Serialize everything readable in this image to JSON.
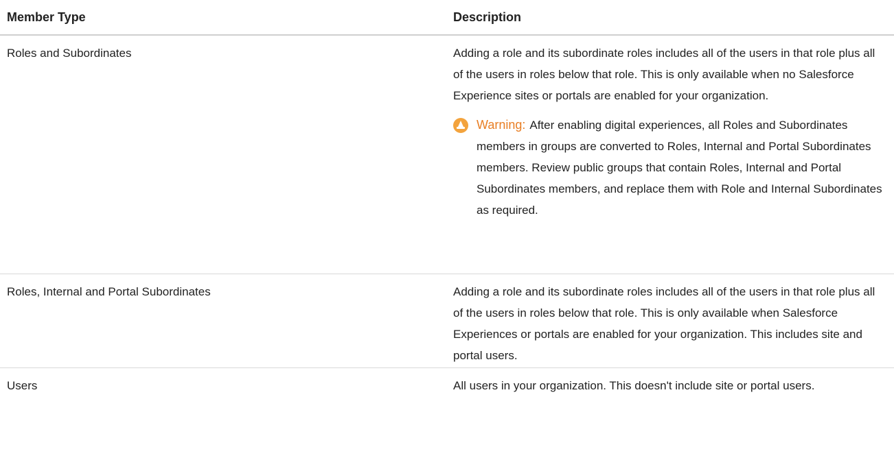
{
  "table": {
    "headers": {
      "member_type": "Member Type",
      "description": "Description"
    },
    "rows": [
      {
        "member_type": "Roles and Subordinates",
        "description": "Adding a role and its subordinate roles includes all of the users in that role plus all of the users in roles below that role. This is only available when no Salesforce Experience sites or portals are enabled for your organization.",
        "warning": {
          "icon": "warning-cone-icon",
          "label": "Warning:",
          "text": "After enabling digital experiences, all Roles and Subordinates members in groups are converted to Roles, Internal and Portal Subordinates members. Review public groups that contain Roles, Internal and Portal Subordinates members, and replace them with Role and Internal Subordinates as required."
        }
      },
      {
        "member_type": "Roles, Internal and Portal Subordinates",
        "description": "Adding a role and its subordinate roles includes all of the users in that role plus all of the users in roles below that role. This is only available when Salesforce Experiences or portals are enabled for your organization. This includes site and portal users."
      },
      {
        "member_type": "Users",
        "description": "All users in your organization. This doesn't include site or portal users."
      }
    ]
  },
  "colors": {
    "warning_accent": "#e87e24",
    "warning_icon_bg": "#f3a33d",
    "divider": "#d8d8d8"
  }
}
